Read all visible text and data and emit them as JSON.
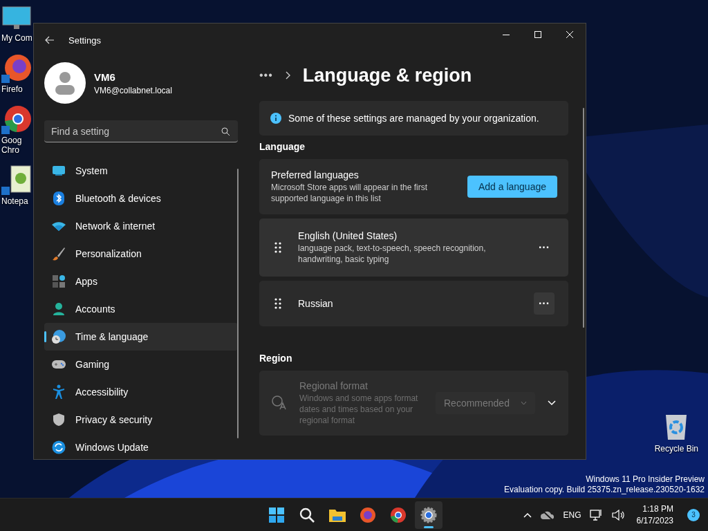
{
  "desktop": {
    "icons": [
      {
        "kind": "monitor",
        "lines": [
          "My Com"
        ]
      },
      {
        "kind": "firefox",
        "lines": [
          "Firefo"
        ]
      },
      {
        "kind": "chrome",
        "lines": [
          "Goog",
          "Chro"
        ]
      },
      {
        "kind": "notepad",
        "lines": [
          "Notepa"
        ]
      }
    ],
    "recycle_bin": {
      "label": "Recycle Bin"
    },
    "build_info": [
      "Windows 11 Pro Insider Preview",
      "Evaluation copy. Build 25375.zn_release.230520-1632"
    ]
  },
  "window": {
    "title": "Settings",
    "profile": {
      "name": "VM6",
      "email": "VM6@collabnet.local"
    },
    "search": {
      "placeholder": "Find a setting"
    },
    "sidebar": {
      "items": [
        {
          "kind": "system",
          "label": "System",
          "selected": false
        },
        {
          "kind": "bluetooth",
          "label": "Bluetooth & devices",
          "selected": false
        },
        {
          "kind": "network",
          "label": "Network & internet",
          "selected": false
        },
        {
          "kind": "personalization",
          "label": "Personalization",
          "selected": false
        },
        {
          "kind": "apps",
          "label": "Apps",
          "selected": false
        },
        {
          "kind": "accounts",
          "label": "Accounts",
          "selected": false
        },
        {
          "kind": "time",
          "label": "Time & language",
          "selected": true
        },
        {
          "kind": "gaming",
          "label": "Gaming",
          "selected": false
        },
        {
          "kind": "accessibility",
          "label": "Accessibility",
          "selected": false
        },
        {
          "kind": "privacy",
          "label": "Privacy & security",
          "selected": false
        },
        {
          "kind": "update",
          "label": "Windows Update",
          "selected": false
        }
      ]
    },
    "breadcrumb": {
      "overflow": "•••",
      "title": "Language & region"
    },
    "notice": "Some of these settings are managed by your organization.",
    "language": {
      "heading": "Language",
      "preferred": {
        "title": "Preferred languages",
        "description": "Microsoft Store apps will appear in the first supported language in this list",
        "button": "Add a language"
      },
      "languages": [
        {
          "name": "English (United States)",
          "features": "language pack, text-to-speech, speech recognition, handwriting, basic typing",
          "more": "···"
        },
        {
          "name": "Russian",
          "more": "···"
        }
      ]
    },
    "region": {
      "heading": "Region",
      "regional_format": {
        "title": "Regional format",
        "description": "Windows and some apps format dates and times based on your regional format",
        "value": "Recommended",
        "disabled": true,
        "expanded": false
      }
    }
  },
  "taskbar": {
    "apps": [
      {
        "kind": "start",
        "selected": false
      },
      {
        "kind": "search",
        "selected": false
      },
      {
        "kind": "explorer",
        "selected": false
      },
      {
        "kind": "firefox",
        "selected": false
      },
      {
        "kind": "chrome",
        "selected": false
      },
      {
        "kind": "settings",
        "selected": true
      }
    ],
    "language": "ENG",
    "time": "1:18 PM",
    "date": "6/17/2023",
    "notifications": "3"
  }
}
